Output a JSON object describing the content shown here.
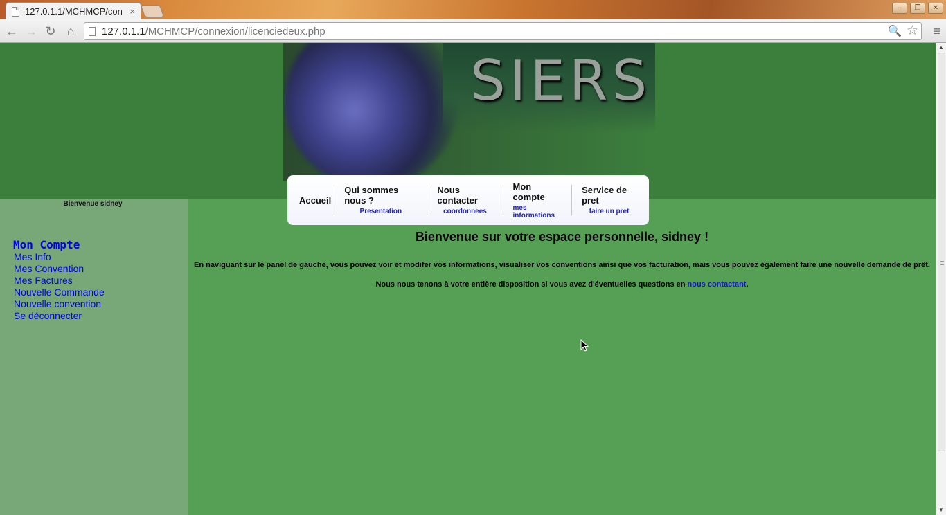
{
  "browser": {
    "tab_title": "127.0.1.1/MCHMCP/con",
    "tab_close": "×",
    "url_host": "127.0.1.1",
    "url_path": "/MCHMCP/connexion/licenciedeux.php"
  },
  "site": {
    "logo_text": "SIERS"
  },
  "nav": [
    {
      "label": "Accueil",
      "sub": ""
    },
    {
      "label": "Qui sommes nous ?",
      "sub": "Presentation"
    },
    {
      "label": "Nous contacter",
      "sub": "coordonnees"
    },
    {
      "label": "Mon compte",
      "sub": "mes informations"
    },
    {
      "label": "Service de pret",
      "sub": "faire un pret"
    }
  ],
  "sidebar": {
    "welcome": "Bienvenue sidney",
    "title": "Mon Compte",
    "links": [
      "Mes Info",
      "Mes Convention",
      "Mes Factures",
      "Nouvelle Commande",
      "Nouvelle convention",
      "Se déconnecter"
    ]
  },
  "content": {
    "heading": "Bienvenue sur votre espace personnelle, sidney !",
    "paragraph1": "En naviguant sur le panel de gauche, vous pouvez voir et modifer vos informations, visualiser vos conventions ainsi que vos facturation, mais vous pouvez également faire une nouvelle demande de prêt.",
    "paragraph2_before": "Nous nous tenons à votre entière disposition si vous avez d'éventuelles questions en ",
    "paragraph2_link": "nous contactant",
    "paragraph2_after": "."
  },
  "colors": {
    "header_green": "#3c7f3d",
    "content_green": "#56a055",
    "sidebar_green": "#78a878",
    "link_blue": "#0000ee"
  }
}
